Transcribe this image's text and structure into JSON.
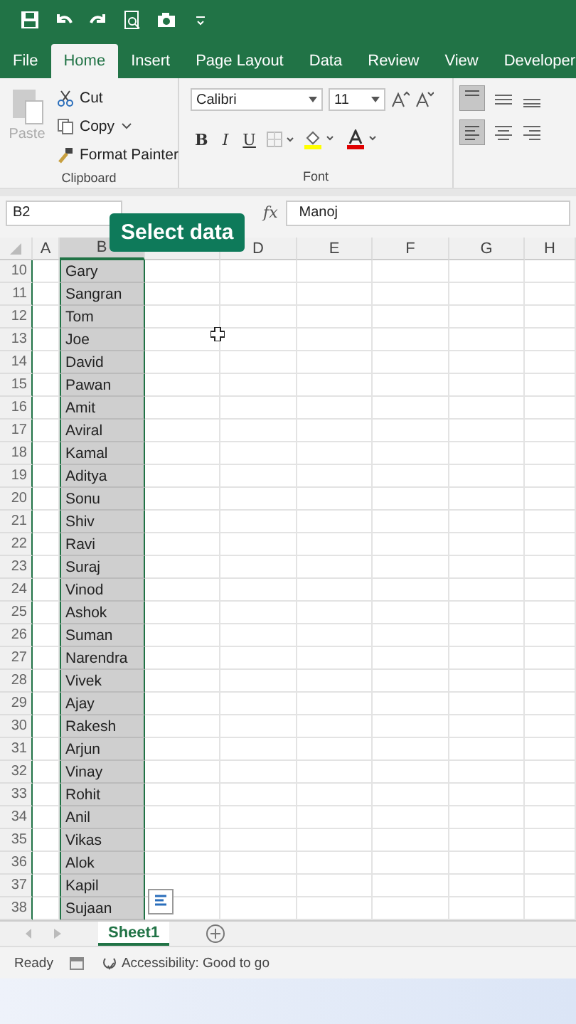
{
  "ribbon_tabs": [
    {
      "label": "File",
      "selected": false
    },
    {
      "label": "Home",
      "selected": true
    },
    {
      "label": "Insert",
      "selected": false
    },
    {
      "label": "Page Layout",
      "selected": false
    },
    {
      "label": "Data",
      "selected": false
    },
    {
      "label": "Review",
      "selected": false
    },
    {
      "label": "View",
      "selected": false
    },
    {
      "label": "Developer",
      "selected": false
    }
  ],
  "clipboard": {
    "paste": {
      "label": "Paste",
      "disabled": true
    },
    "cut": "Cut",
    "copy": "Copy",
    "format_painter": "Format Painter",
    "group_label": "Clipboard"
  },
  "font": {
    "name": "Calibri",
    "size": "11",
    "bold": "B",
    "italic": "I",
    "underline": "U",
    "group_label": "Font"
  },
  "formula_bar": {
    "name_box": "B2",
    "fx": "fx",
    "value": "Manoj"
  },
  "callout": "Select data",
  "columns": [
    {
      "label": "A",
      "selected": false
    },
    {
      "label": "B",
      "selected": true
    },
    {
      "selected": false
    },
    {
      "label": "D",
      "selected": false
    },
    {
      "label": "E",
      "selected": false
    },
    {
      "label": "F",
      "selected": false
    },
    {
      "label": "G",
      "selected": false
    },
    {
      "label": "H",
      "selected": false
    }
  ],
  "rows": [
    {
      "number": "10",
      "b": "Gary"
    },
    {
      "number": "11",
      "b": "Sangran"
    },
    {
      "number": "12",
      "b": "Tom"
    },
    {
      "number": "13",
      "b": "Joe"
    },
    {
      "number": "14",
      "b": "David"
    },
    {
      "number": "15",
      "b": "Pawan"
    },
    {
      "number": "16",
      "b": "Amit"
    },
    {
      "number": "17",
      "b": "Aviral"
    },
    {
      "number": "18",
      "b": "Kamal"
    },
    {
      "number": "19",
      "b": "Aditya"
    },
    {
      "number": "20",
      "b": "Sonu"
    },
    {
      "number": "21",
      "b": "Shiv"
    },
    {
      "number": "22",
      "b": "Ravi"
    },
    {
      "number": "23",
      "b": "Suraj"
    },
    {
      "number": "24",
      "b": "Vinod"
    },
    {
      "number": "25",
      "b": "Ashok"
    },
    {
      "number": "26",
      "b": "Suman"
    },
    {
      "number": "27",
      "b": "Narendra"
    },
    {
      "number": "28",
      "b": "Vivek"
    },
    {
      "number": "29",
      "b": "Ajay"
    },
    {
      "number": "30",
      "b": "Rakesh"
    },
    {
      "number": "31",
      "b": "Arjun"
    },
    {
      "number": "32",
      "b": "Vinay"
    },
    {
      "number": "33",
      "b": "Rohit"
    },
    {
      "number": "34",
      "b": "Anil"
    },
    {
      "number": "35",
      "b": "Vikas"
    },
    {
      "number": "36",
      "b": "Alok"
    },
    {
      "number": "37",
      "b": "Kapil"
    },
    {
      "number": "38",
      "b": "Sujaan"
    }
  ],
  "sheet_tabs": [
    {
      "label": "Sheet1",
      "selected": true
    }
  ],
  "status_bar": {
    "ready": "Ready",
    "accessibility": "Accessibility: Good to go"
  }
}
